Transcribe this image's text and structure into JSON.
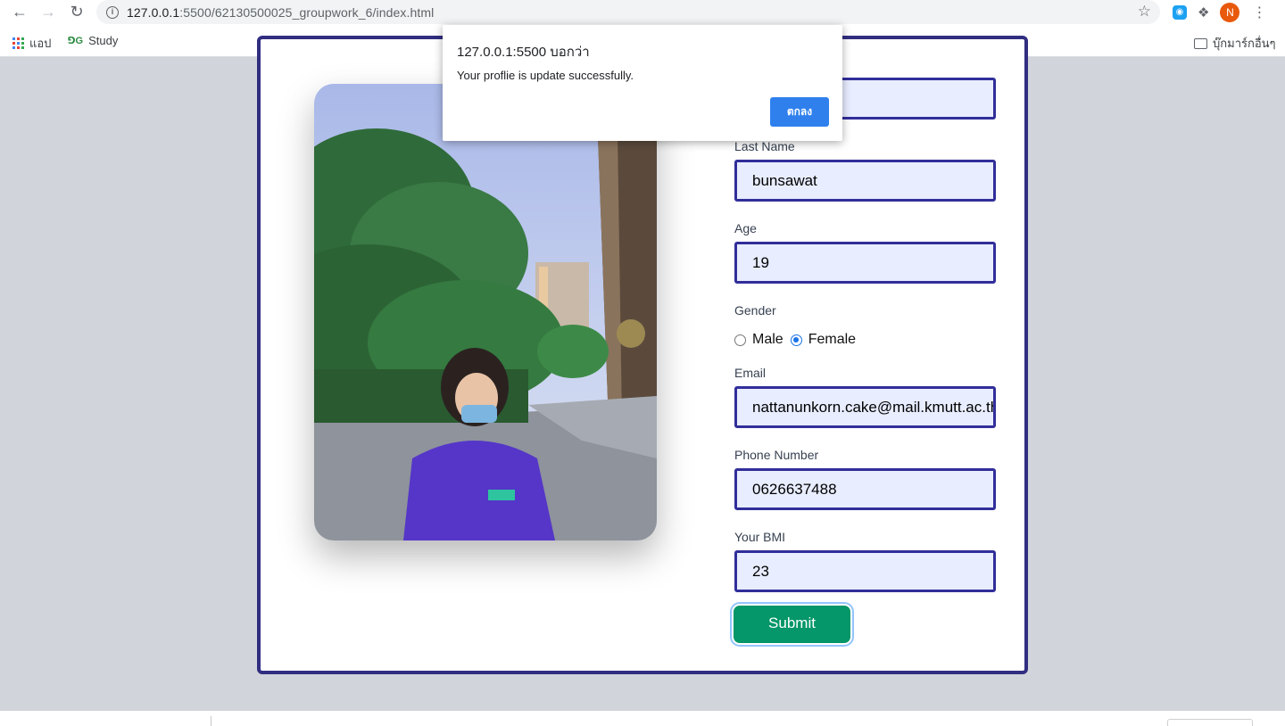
{
  "browser": {
    "url_host": "127.0.0.1",
    "url_rest": ":5500/62130500025_groupwork_6/index.html",
    "avatar_letter": "N",
    "bookmarks": {
      "apps": "แอป",
      "study": "Study",
      "other": "บุ๊กมาร์กอื่นๆ"
    }
  },
  "dialog": {
    "title": "127.0.0.1:5500 บอกว่า",
    "message": "Your proflie is update successfully.",
    "ok_label": "ตกลง"
  },
  "form": {
    "first_name_value": "",
    "last_name_label": "Last Name",
    "last_name_value": "bunsawat",
    "age_label": "Age",
    "age_value": "19",
    "gender_label": "Gender",
    "gender_male": "Male",
    "gender_female": "Female",
    "gender_selected": "Female",
    "email_label": "Email",
    "email_value": "nattanunkorn.cake@mail.kmutt.ac.th",
    "phone_label": "Phone Number",
    "phone_value": "0626637488",
    "bmi_label": "Your BMI",
    "bmi_value": "23",
    "submit_label": "Submit"
  },
  "colors": {
    "border_accent": "#312e81",
    "input_bg": "#e8edff",
    "submit_bg": "#059669",
    "dialog_button": "#2f80ed"
  }
}
